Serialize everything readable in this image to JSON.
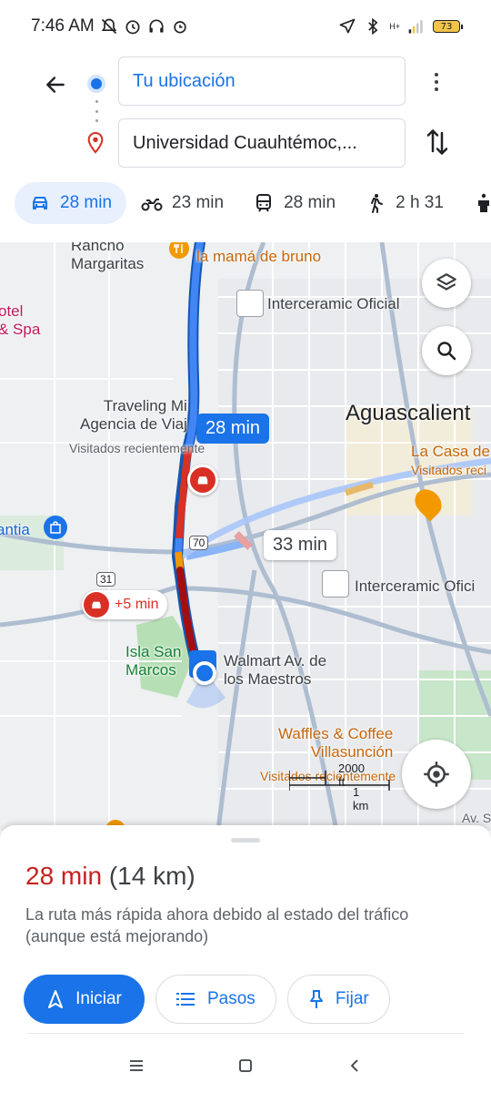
{
  "status_bar": {
    "time": "7:46 AM",
    "network": "H+",
    "battery": "73"
  },
  "search": {
    "origin": "Tu ubicación",
    "destination": "Universidad Cuauhtémoc,..."
  },
  "modes": [
    {
      "icon": "car-icon",
      "label": "28 min",
      "active": true
    },
    {
      "icon": "motorcycle-icon",
      "label": "23 min",
      "active": false
    },
    {
      "icon": "transit-icon",
      "label": "28 min",
      "active": false
    },
    {
      "icon": "walk-icon",
      "label": "2 h 31",
      "active": false
    }
  ],
  "map": {
    "labels": {
      "rancho": "Rancho\nMargaritas",
      "mama_bruno": "la mamá de bruno",
      "interceramic_1": "Interceramic Oficial",
      "hotel": "otel\n& Spa",
      "traveling": "Traveling Mi\nAgencia de Viaj",
      "visited_1": "Visitados recientemente",
      "aguascalientes": "Aguascalient",
      "la_casa": "La Casa de",
      "visited_2": "Visitados reci",
      "plaza": "antia",
      "route_70": "70",
      "route_31": "31",
      "interceramic_2": "Interceramic Ofici",
      "isla": "Isla San\nMarcos",
      "walmart": "Walmart Av. de\nlos Maestros",
      "waffles": "Waffles & Coffee\nVillasunción",
      "visited_3": "Visitados recientemente",
      "road": "Av. Si"
    },
    "primary_time": "28 min",
    "alt_time": "33 min",
    "delay": "+5 min",
    "scale_ft": "2000 ft",
    "scale_km": "1 km"
  },
  "sheet": {
    "time": "28 min",
    "distance": "(14 km)",
    "description": "La ruta más rápida ahora debido al estado del tráfico (aunque está mejorando)",
    "start_label": "Iniciar",
    "steps_label": "Pasos",
    "pin_label": "Fijar"
  },
  "colors": {
    "accent": "#1a73e8",
    "traffic_red": "#c5221f",
    "traffic_orange": "#f29900"
  }
}
